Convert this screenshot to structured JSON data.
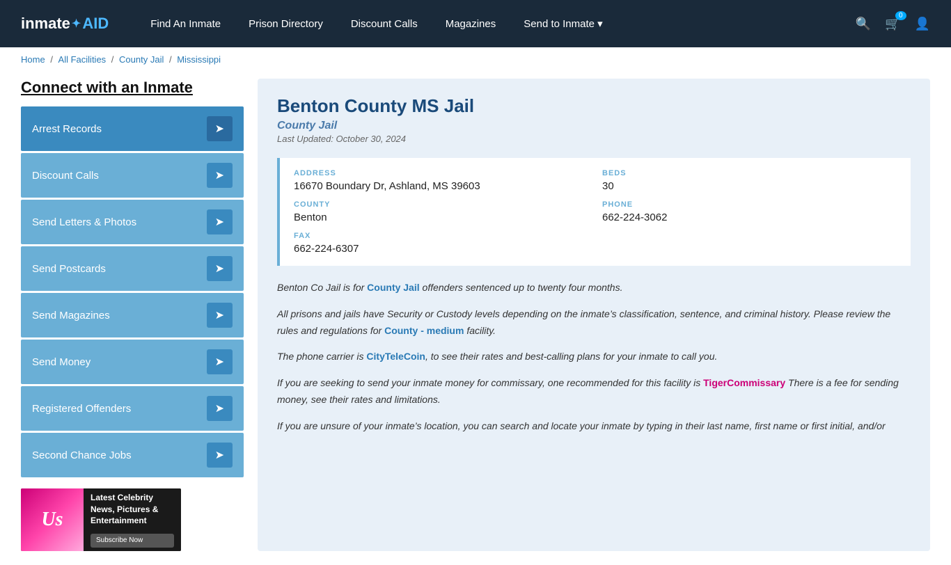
{
  "header": {
    "logo": "inmateAID",
    "logo_part1": "inmate",
    "logo_part2": "AID",
    "nav": [
      {
        "label": "Find An Inmate",
        "id": "find-inmate"
      },
      {
        "label": "Prison Directory",
        "id": "prison-directory"
      },
      {
        "label": "Discount Calls",
        "id": "discount-calls"
      },
      {
        "label": "Magazines",
        "id": "magazines"
      },
      {
        "label": "Send to Inmate ▾",
        "id": "send-to-inmate"
      }
    ],
    "cart_count": "0"
  },
  "breadcrumb": {
    "items": [
      "Home",
      "All Facilities",
      "County Jail",
      "Mississippi"
    ]
  },
  "sidebar": {
    "title": "Connect with an Inmate",
    "menu_items": [
      "Arrest Records",
      "Discount Calls",
      "Send Letters & Photos",
      "Send Postcards",
      "Send Magazines",
      "Send Money",
      "Registered Offenders",
      "Second Chance Jobs"
    ],
    "ad": {
      "brand": "Us",
      "title": "Latest Celebrity News, Pictures & Entertainment",
      "subscribe_label": "Subscribe Now"
    }
  },
  "facility": {
    "title": "Benton County MS Jail",
    "type": "County Jail",
    "last_updated": "Last Updated: October 30, 2024",
    "address_label": "ADDRESS",
    "address_value": "16670 Boundary Dr, Ashland, MS 39603",
    "beds_label": "BEDS",
    "beds_value": "30",
    "county_label": "COUNTY",
    "county_value": "Benton",
    "phone_label": "PHONE",
    "phone_value": "662-224-3062",
    "fax_label": "FAX",
    "fax_value": "662-224-6307"
  },
  "description": {
    "p1_before": "Benton Co Jail is for ",
    "p1_link": "County Jail",
    "p1_after": " offenders sentenced up to twenty four months.",
    "p2": "All prisons and jails have Security or Custody levels depending on the inmate’s classification, sentence, and criminal history. Please review the rules and regulations for ",
    "p2_link": "County - medium",
    "p2_after": " facility.",
    "p3_before": "The phone carrier is ",
    "p3_link": "CityTeleCoin",
    "p3_after": ", to see their rates and best-calling plans for your inmate to call you.",
    "p4_before": "If you are seeking to send your inmate money for commissary, one recommended for this facility is ",
    "p4_link": "TigerCommissary",
    "p4_after": " There is a fee for sending money, see their rates and limitations.",
    "p5": "If you are unsure of your inmate’s location, you can search and locate your inmate by typing in their last name, first name or first initial, and/or"
  }
}
